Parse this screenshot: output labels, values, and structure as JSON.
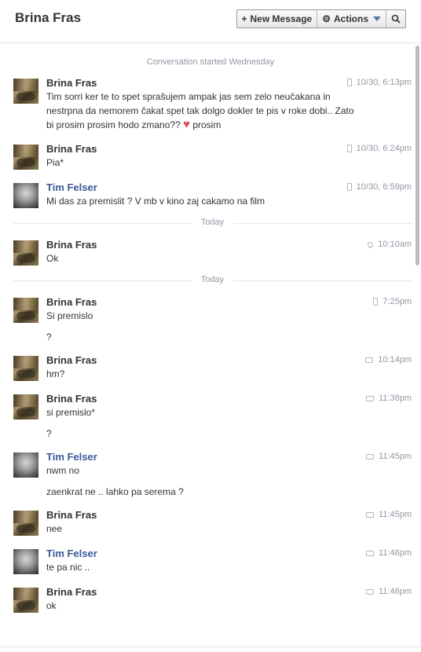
{
  "header": {
    "title": "Brina Fras",
    "new_message_label": "New Message",
    "actions_label": "Actions"
  },
  "conversation_started": "Conversation started Wednesday",
  "dividers": [
    "Today",
    "Today"
  ],
  "messages": [
    {
      "sender": "Brina Fras",
      "time": "10/30, 6:13pm",
      "via": "phone-icon",
      "lines": [
        "Tim sorri ker te to spet sprašujem ampak jas sem zelo neučakana in nestrpna da nemorem čakat spet tak dolgo dokler te pis v roke dobi.. Zato bi prosim prosim hodo zmano?? ♥ prosim"
      ]
    },
    {
      "sender": "Brina Fras",
      "time": "10/30, 6:24pm",
      "via": "phone-icon",
      "lines": [
        "Pia*"
      ]
    },
    {
      "sender": "Tim Felser",
      "time": "10/30, 6:59pm",
      "via": "phone-icon",
      "lines": [
        "Mi das za premislit ? V mb v kino zaj cakamo na film"
      ]
    },
    {
      "sender": "Brina Fras",
      "time": "10:10am",
      "via": "location-icon",
      "lines": [
        "Ok"
      ]
    },
    {
      "sender": "Brina Fras",
      "time": "7:25pm",
      "via": "phone-icon",
      "lines": [
        "Si premislo",
        "?"
      ]
    },
    {
      "sender": "Brina Fras",
      "time": "10:14pm",
      "via": "chat-icon",
      "lines": [
        "hm?"
      ]
    },
    {
      "sender": "Brina Fras",
      "time": "11:38pm",
      "via": "chat-icon",
      "lines": [
        "si premislo*",
        "?"
      ]
    },
    {
      "sender": "Tim Felser",
      "time": "11:45pm",
      "via": "chat-icon",
      "lines": [
        "nwm no",
        "zaenkrat ne .. lahko pa serema ?"
      ]
    },
    {
      "sender": "Brina Fras",
      "time": "11:45pm",
      "via": "chat-icon",
      "lines": [
        "nee"
      ]
    },
    {
      "sender": "Tim Felser",
      "time": "11:46pm",
      "via": "chat-icon",
      "lines": [
        "te pa nic .."
      ]
    },
    {
      "sender": "Brina Fras",
      "time": "11:46pm",
      "via": "chat-icon",
      "lines": [
        "ok"
      ]
    }
  ],
  "colors": {
    "link": "#3b5998",
    "meta": "#9197a3",
    "heart": "#e0515c"
  }
}
